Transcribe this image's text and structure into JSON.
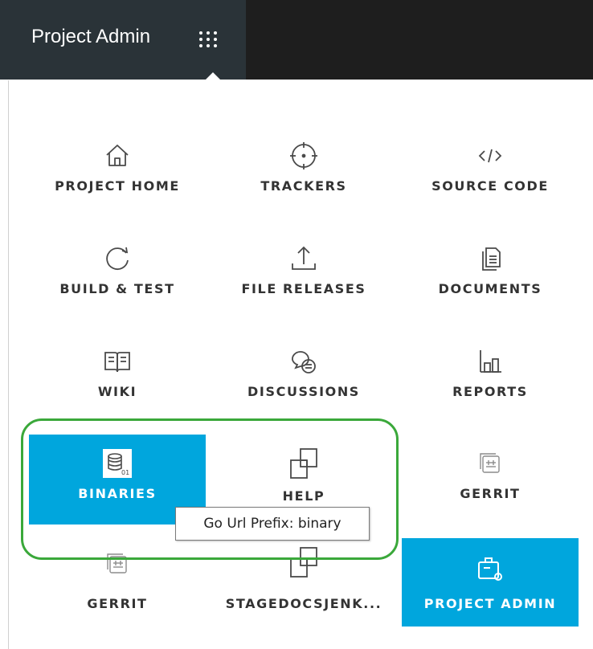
{
  "header": {
    "title": "Project Admin",
    "menu_icon": "app-grid-icon"
  },
  "colors": {
    "topbar": "#1e1e1e",
    "title_tab": "#2a3338",
    "accent": "#00a6dd",
    "highlight": "#3aa83a"
  },
  "tiles": [
    {
      "label": "PROJECT HOME",
      "icon": "home-icon"
    },
    {
      "label": "TRACKERS",
      "icon": "crosshair-icon"
    },
    {
      "label": "SOURCE CODE",
      "icon": "code-icon"
    },
    {
      "label": "BUILD & TEST",
      "icon": "refresh-icon"
    },
    {
      "label": "FILE RELEASES",
      "icon": "upload-icon"
    },
    {
      "label": "DOCUMENTS",
      "icon": "documents-icon"
    },
    {
      "label": "WIKI",
      "icon": "book-icon"
    },
    {
      "label": "DISCUSSIONS",
      "icon": "chat-bubbles-icon"
    },
    {
      "label": "REPORTS",
      "icon": "bar-chart-icon"
    },
    {
      "label": "BINARIES",
      "icon": "database-icon",
      "state": "active"
    },
    {
      "label": "HELP",
      "icon": "squares-link-icon"
    },
    {
      "label": "GERRIT",
      "icon": "gerrit-icon"
    },
    {
      "label": "GERRIT",
      "icon": "gerrit-icon"
    },
    {
      "label": "STAGEDOCSJENK...",
      "icon": "squares-link-icon"
    },
    {
      "label": "PROJECT ADMIN",
      "icon": "briefcase-icon",
      "state": "active"
    }
  ],
  "tooltip": {
    "text": "Go Url Prefix: binary"
  }
}
